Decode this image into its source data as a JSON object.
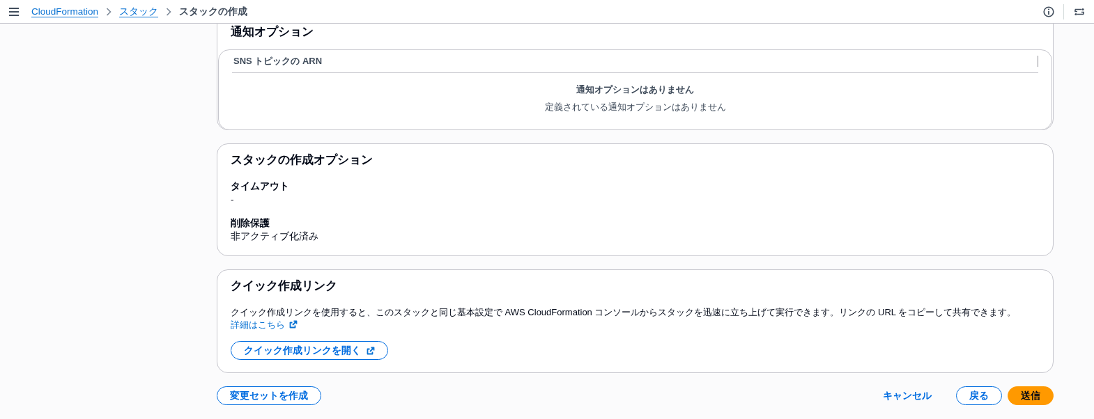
{
  "top_nav": {
    "breadcrumbs": [
      {
        "label": "CloudFormation",
        "kind": "link"
      },
      {
        "label": "スタック",
        "kind": "link"
      },
      {
        "label": "スタックの作成",
        "kind": "current"
      }
    ]
  },
  "notification_options": {
    "title": "通知オプション",
    "table": {
      "columns": [
        "SNS トピックの ARN"
      ],
      "empty_title": "通知オプションはありません",
      "empty_description": "定義されている通知オプションはありません"
    }
  },
  "stack_creation_options": {
    "title": "スタックの作成オプション",
    "fields": [
      {
        "label": "タイムアウト",
        "value": "-"
      },
      {
        "label": "削除保護",
        "value": "非アクティブ化済み"
      }
    ]
  },
  "quick_create_link": {
    "title": "クイック作成リンク",
    "description": "クイック作成リンクを使用すると、このスタックと同じ基本設定で AWS CloudFormation コンソールからスタックを迅速に立ち上げて実行できます。リンクの URL をコピーして共有できます。",
    "learn_more_link": "詳細はこちら",
    "button": "クイック作成リンクを開く"
  },
  "footer": {
    "secondary_button": "変更セットを作成",
    "actions": [
      {
        "label": "キャンセル",
        "kind": "link"
      },
      {
        "label": "戻る",
        "kind": "normal"
      },
      {
        "label": "送信",
        "kind": "primary"
      }
    ]
  }
}
